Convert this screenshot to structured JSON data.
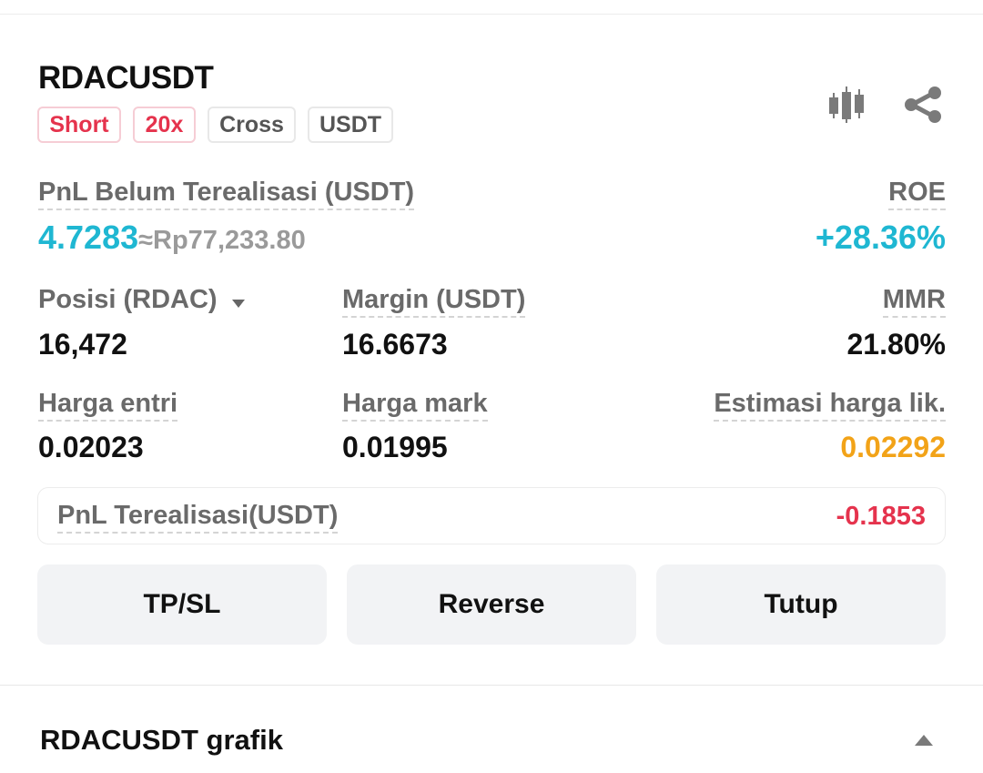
{
  "position": {
    "symbol": "RDACUSDT",
    "tags": [
      "Short",
      "20x",
      "Cross",
      "USDT"
    ]
  },
  "icons": {
    "chart": "candlestick-chart-icon",
    "share": "share-icon",
    "expand": "caret-up-icon",
    "dropdown": "caret-down-icon"
  },
  "unrealized": {
    "label": "PnL Belum Terealisasi (USDT)",
    "value": "4.7283",
    "approx": "≈Rp77,233.80",
    "roe_label": "ROE",
    "roe_value": "+28.36%"
  },
  "stats_row1": {
    "position_label": "Posisi (RDAC)",
    "position_value": "16,472",
    "margin_label": "Margin (USDT)",
    "margin_value": "16.6673",
    "mmr_label": "MMR",
    "mmr_value": "21.80%"
  },
  "stats_row2": {
    "entry_label": "Harga entri",
    "entry_value": "0.02023",
    "mark_label": "Harga mark",
    "mark_value": "0.01995",
    "liq_label": "Estimasi harga lik.",
    "liq_value": "0.02292"
  },
  "realized": {
    "label": "PnL Terealisasi(USDT)",
    "value": "-0.1853"
  },
  "actions": {
    "tpsl": "TP/SL",
    "reverse": "Reverse",
    "close": "Tutup"
  },
  "chart_section": {
    "title": "RDACUSDT grafik"
  },
  "colors": {
    "profit": "#1fb7d2",
    "loss": "#e5334d",
    "liquidation": "#f2a318",
    "button_bg": "#f2f3f5"
  }
}
